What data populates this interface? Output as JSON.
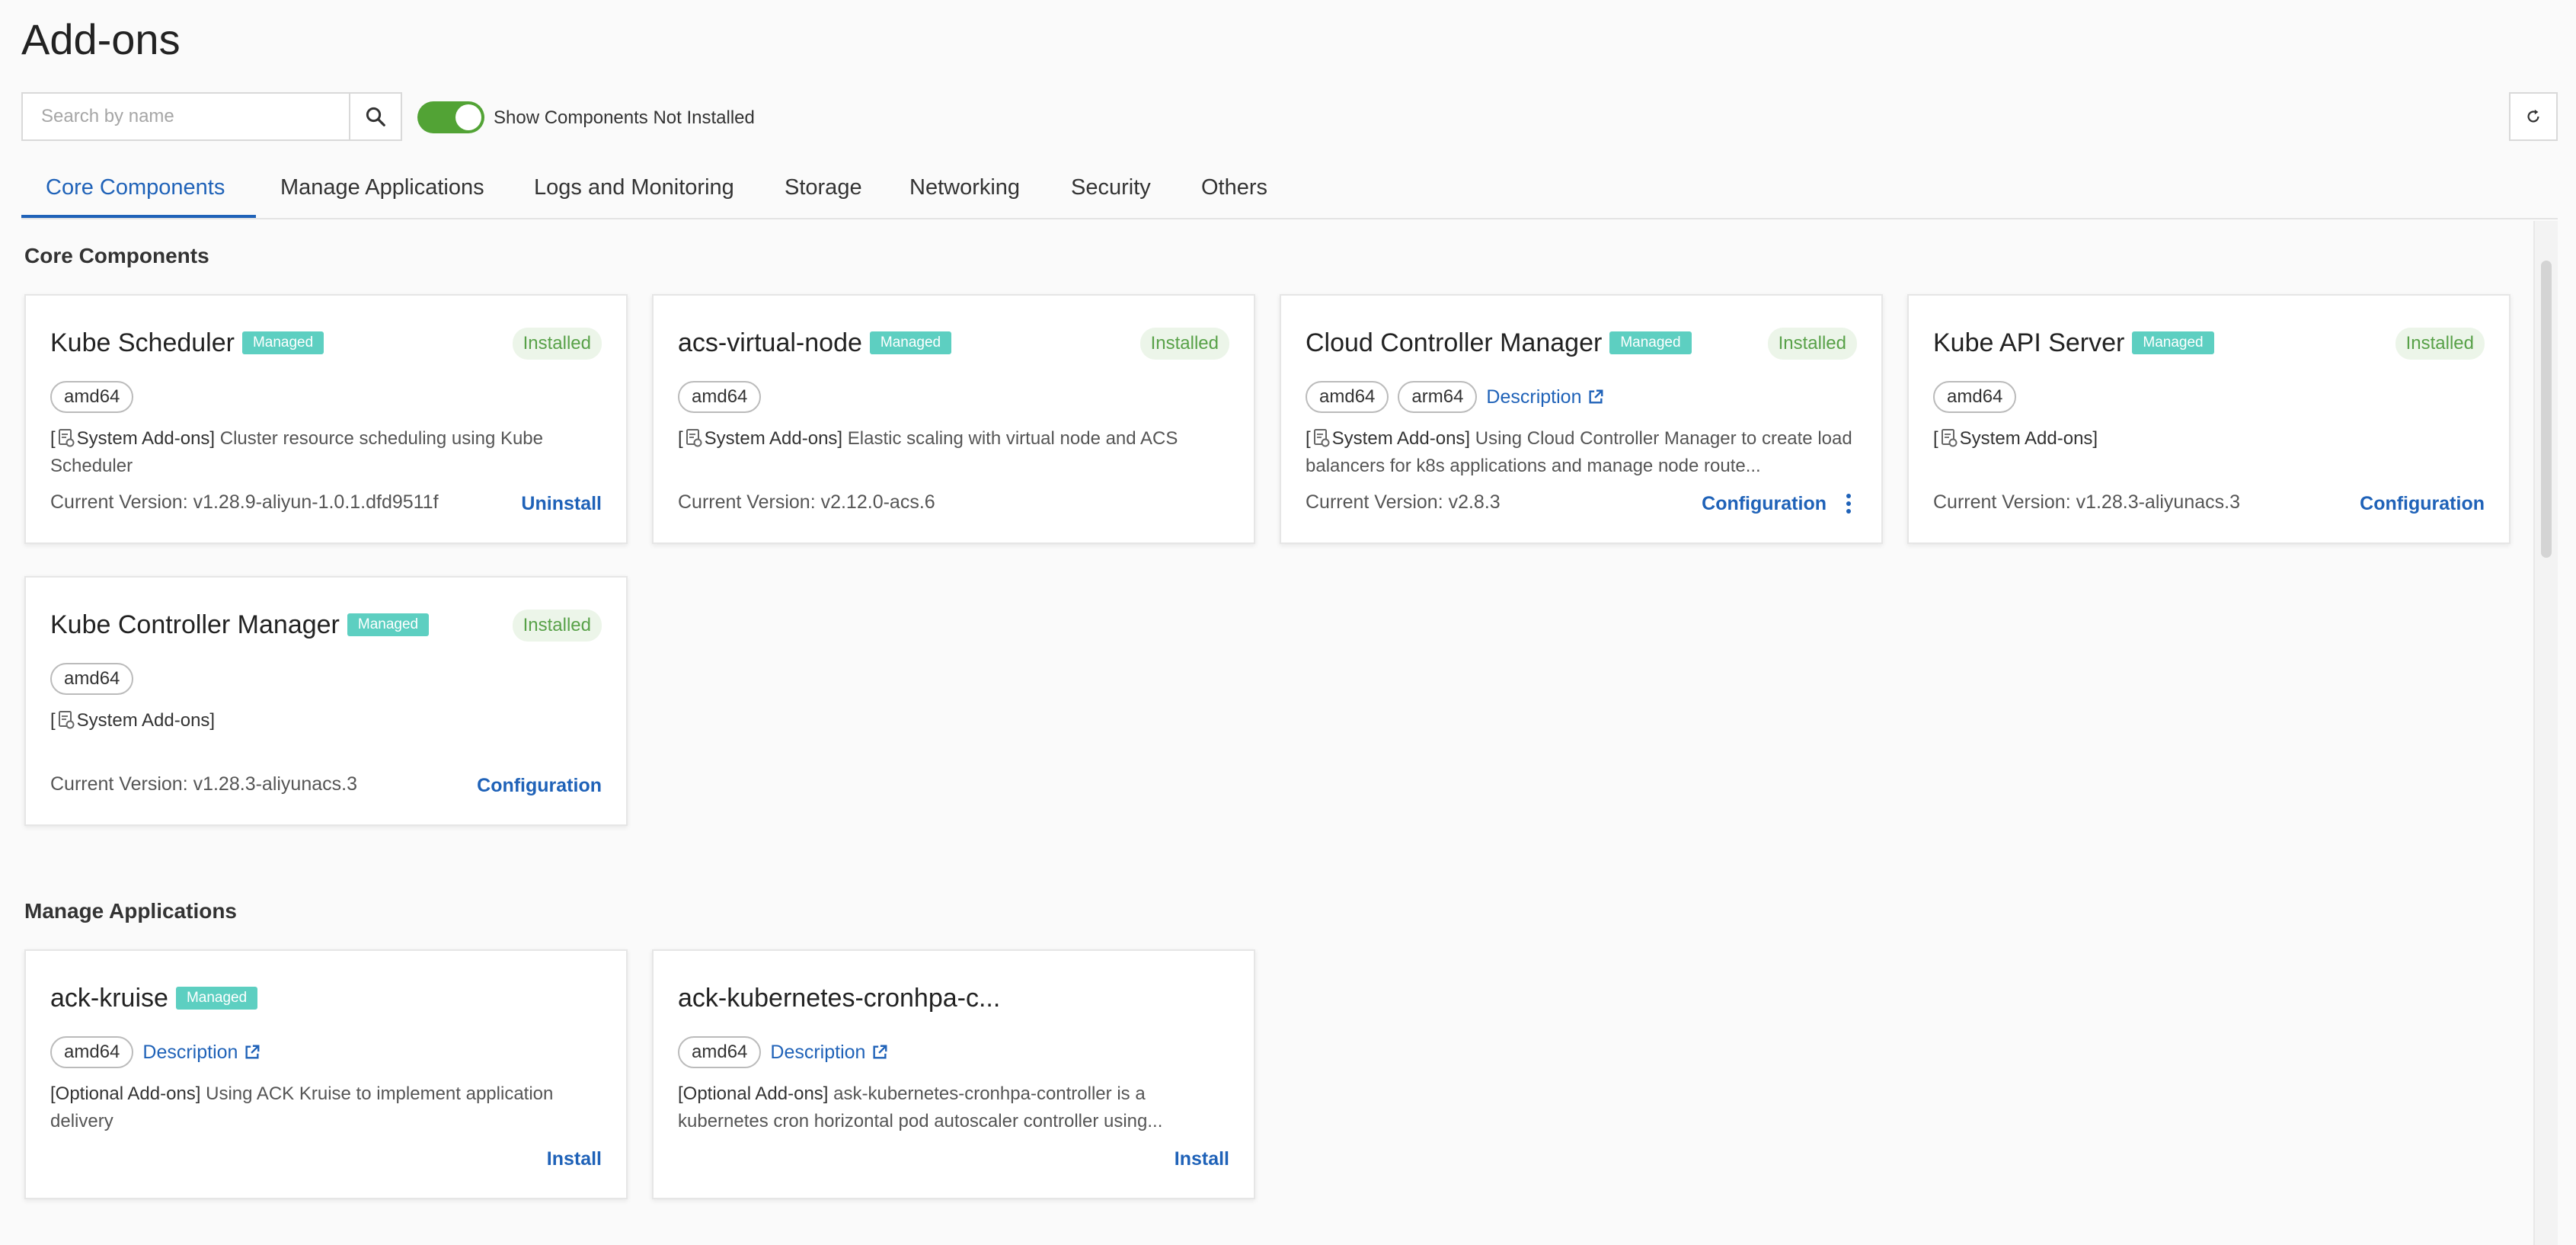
{
  "page": {
    "title": "Add-ons"
  },
  "toolbar": {
    "search_placeholder": "Search by name",
    "toggle_label": "Show Components Not Installed",
    "toggle_on": true
  },
  "tabs": [
    {
      "label": "Core Components",
      "active": true
    },
    {
      "label": "Manage Applications"
    },
    {
      "label": "Logs and Monitoring"
    },
    {
      "label": "Storage"
    },
    {
      "label": "Networking"
    },
    {
      "label": "Security"
    },
    {
      "label": "Others"
    }
  ],
  "sections": {
    "core": {
      "title": "Core Components"
    },
    "manage": {
      "title": "Manage Applications"
    }
  },
  "labels": {
    "managed": "Managed",
    "description": "Description"
  },
  "cards": [
    {
      "name": "Kube Scheduler",
      "managed": "Managed",
      "status": "Installed",
      "archs": [
        "amd64"
      ],
      "desc_bracket_open": "[",
      "desc_category": "System Add-ons]",
      "desc_text": " Cluster resource scheduling using Kube Scheduler",
      "version": "Current Version: v1.28.9-aliyun-1.0.1.dfd9511f",
      "action": "Uninstall"
    },
    {
      "name": "acs-virtual-node",
      "managed": "Managed",
      "status": "Installed",
      "archs": [
        "amd64"
      ],
      "desc_bracket_open": "[",
      "desc_category": "System Add-ons]",
      "desc_text": " Elastic scaling with virtual node and ACS",
      "version": "Current Version: v2.12.0-acs.6",
      "action": ""
    },
    {
      "name": "Cloud Controller Manager",
      "managed": "Managed",
      "status": "Installed",
      "archs": [
        "amd64",
        "arm64"
      ],
      "description_link": "Description",
      "desc_bracket_open": "[",
      "desc_category": "System Add-ons]",
      "desc_text": " Using Cloud Controller Manager to create load balancers for k8s applications and manage node route...",
      "version": "Current Version: v2.8.3",
      "action": "Configuration"
    },
    {
      "name": "Kube API Server",
      "managed": "Managed",
      "status": "Installed",
      "archs": [
        "amd64"
      ],
      "desc_bracket_open": "[",
      "desc_category": "System Add-ons]",
      "desc_text": "",
      "version": "Current Version: v1.28.3-aliyunacs.3",
      "action": "Configuration"
    },
    {
      "name": "Kube Controller Manager",
      "managed": "Managed",
      "status": "Installed",
      "archs": [
        "amd64"
      ],
      "desc_bracket_open": "[",
      "desc_category": "System Add-ons]",
      "desc_text": "",
      "version": "Current Version: v1.28.3-aliyunacs.3",
      "action": "Configuration"
    },
    {
      "name": "ack-kruise",
      "managed": "Managed",
      "archs": [
        "amd64"
      ],
      "description_link": "Description",
      "desc_category": "[Optional Add-ons]",
      "desc_text": " Using ACK Kruise to implement application delivery",
      "action": "Install"
    },
    {
      "name": "ack-kubernetes-cronhpa-c...",
      "archs": [
        "amd64"
      ],
      "description_link": "Description",
      "desc_category": "[Optional Add-ons]",
      "desc_text": " ask-kubernetes-cronhpa-controller is a kubernetes cron horizontal pod autoscaler controller using...",
      "action": "Install"
    }
  ],
  "colors": {
    "accent": "#1f62b8",
    "toggle": "#52a335",
    "managed_badge": "#5dcfc1",
    "installed": "#58a148"
  }
}
